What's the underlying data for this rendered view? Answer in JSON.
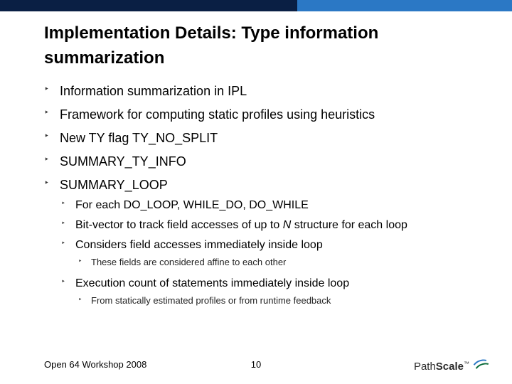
{
  "title_line1": "Implementation Details: Type information",
  "title_line2": "summarization",
  "bullets": {
    "b1": "Information summarization in IPL",
    "b2": "Framework for computing static profiles using heuristics",
    "b3": "New TY flag TY_NO_SPLIT",
    "b4": "SUMMARY_TY_INFO",
    "b5": "SUMMARY_LOOP",
    "b5_1": "For each DO_LOOP, WHILE_DO, DO_WHILE",
    "b5_2_pre": "Bit-vector to track field accesses of up to ",
    "b5_2_ital": "N",
    "b5_2_post": " structure for each loop",
    "b5_3": "Considers field accesses immediately inside loop",
    "b5_3_1": "These fields are considered affine to each other",
    "b5_4": "Execution count of statements immediately inside loop",
    "b5_4_1": "From statically estimated profiles or from runtime feedback"
  },
  "footer": "Open 64 Workshop 2008",
  "page_number": "10",
  "logo": {
    "part1": "Path",
    "part2": "Scale",
    "tm": "™"
  }
}
